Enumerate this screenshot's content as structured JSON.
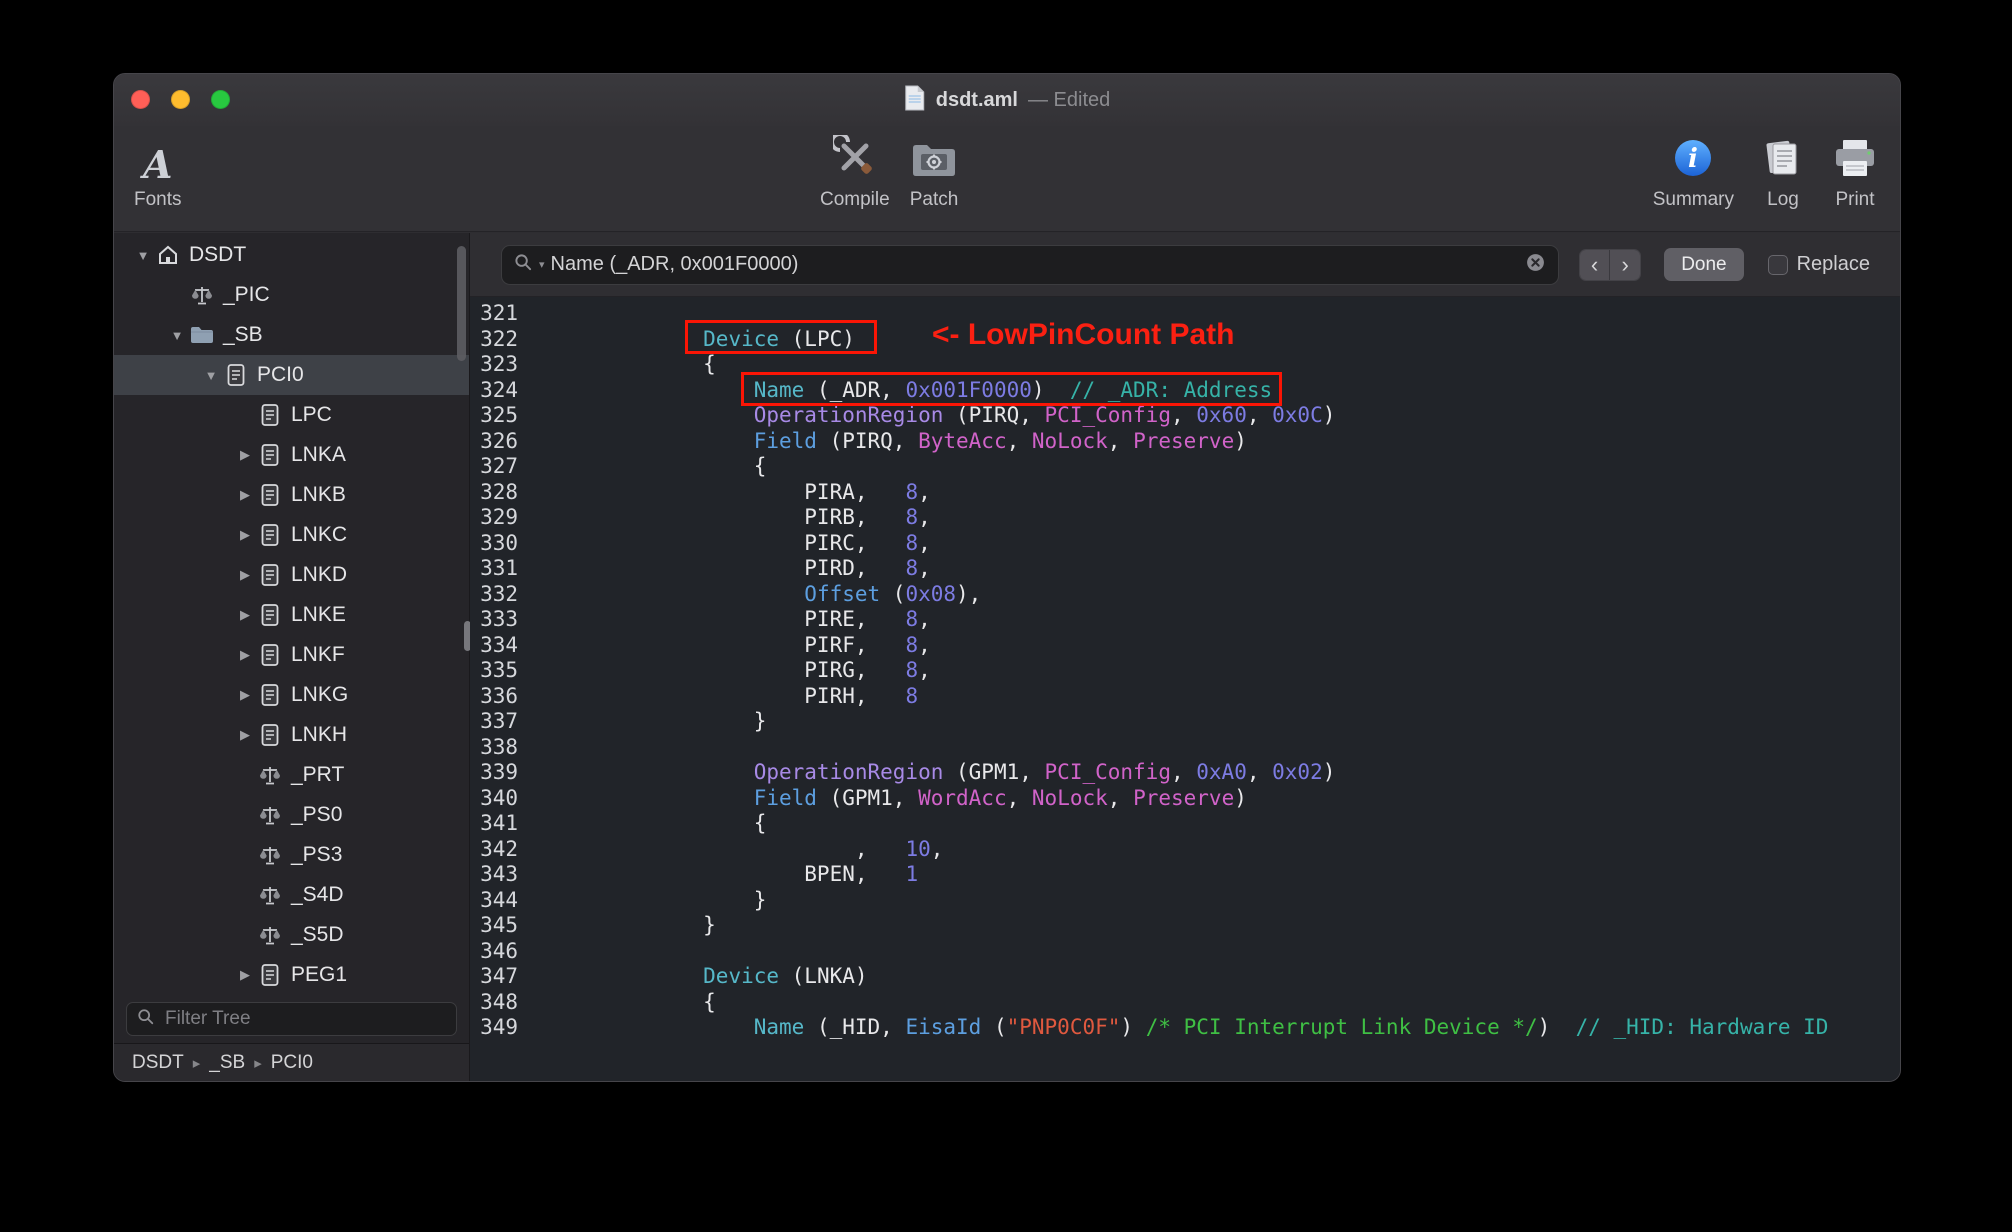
{
  "colors": {
    "annotation_red": "#fb1505",
    "keyword_teal": "#56b8c9",
    "keyword_purple": "#a88ae6",
    "keyword_blue": "#5d9fe0",
    "keyword_pink": "#d163c9",
    "number_purple": "#7d7ce3",
    "comment_teal": "#36b3a8",
    "comment_green": "#3fbf44",
    "string_red": "#e0593f",
    "info_blue": "#2f7cf6",
    "traffic_red": "#ff5f57",
    "traffic_yellow": "#febc2e",
    "traffic_green": "#28c840"
  },
  "window": {
    "title": "dsdt.aml",
    "edited_suffix": "— Edited",
    "toolbar": {
      "fonts": "Fonts",
      "compile": "Compile",
      "patch": "Patch",
      "summary": "Summary",
      "log": "Log",
      "print": "Print"
    }
  },
  "icons": {
    "triangle_open": "▼",
    "triangle_closed": "▶",
    "breadcrumb_separator": "▸",
    "prev": "‹",
    "next": "›",
    "fonts_glyph": "A",
    "search_caret": "▾"
  },
  "sidebar": {
    "filter_placeholder": "Filter Tree",
    "breadcrumb": [
      "DSDT",
      "_SB",
      "PCI0"
    ],
    "tree": [
      {
        "label": "DSDT",
        "icon": "home",
        "disclosure": "open",
        "level": 0,
        "selected": false
      },
      {
        "label": "_PIC",
        "icon": "method",
        "disclosure": "none",
        "level": 1,
        "selected": false
      },
      {
        "label": "_SB",
        "icon": "folder",
        "disclosure": "open",
        "level": 1,
        "selected": false
      },
      {
        "label": "PCI0",
        "icon": "device",
        "disclosure": "open",
        "level": 2,
        "selected": true
      },
      {
        "label": "LPC",
        "icon": "device",
        "disclosure": "none",
        "level": 3,
        "selected": false
      },
      {
        "label": "LNKA",
        "icon": "device",
        "disclosure": "closed",
        "level": 3,
        "selected": false
      },
      {
        "label": "LNKB",
        "icon": "device",
        "disclosure": "closed",
        "level": 3,
        "selected": false
      },
      {
        "label": "LNKC",
        "icon": "device",
        "disclosure": "closed",
        "level": 3,
        "selected": false
      },
      {
        "label": "LNKD",
        "icon": "device",
        "disclosure": "closed",
        "level": 3,
        "selected": false
      },
      {
        "label": "LNKE",
        "icon": "device",
        "disclosure": "closed",
        "level": 3,
        "selected": false
      },
      {
        "label": "LNKF",
        "icon": "device",
        "disclosure": "closed",
        "level": 3,
        "selected": false
      },
      {
        "label": "LNKG",
        "icon": "device",
        "disclosure": "closed",
        "level": 3,
        "selected": false
      },
      {
        "label": "LNKH",
        "icon": "device",
        "disclosure": "closed",
        "level": 3,
        "selected": false
      },
      {
        "label": "_PRT",
        "icon": "method",
        "disclosure": "none",
        "level": 3,
        "selected": false
      },
      {
        "label": "_PS0",
        "icon": "method",
        "disclosure": "none",
        "level": 3,
        "selected": false
      },
      {
        "label": "_PS3",
        "icon": "method",
        "disclosure": "none",
        "level": 3,
        "selected": false
      },
      {
        "label": "_S4D",
        "icon": "method",
        "disclosure": "none",
        "level": 3,
        "selected": false
      },
      {
        "label": "_S5D",
        "icon": "method",
        "disclosure": "none",
        "level": 3,
        "selected": false
      },
      {
        "label": "PEG1",
        "icon": "device",
        "disclosure": "closed",
        "level": 3,
        "selected": false
      }
    ]
  },
  "findbar": {
    "query": "Name (_ADR, 0x001F0000)",
    "done": "Done",
    "replace_label": "Replace"
  },
  "editor": {
    "annotation": "<- LowPinCount Path",
    "lines": [
      {
        "n": 321,
        "s": []
      },
      {
        "n": 322,
        "s": [
          {
            "c": "p",
            "t": "        "
          },
          {
            "c": "k1",
            "t": "Device"
          },
          {
            "c": "p",
            "t": " (LPC)"
          }
        ]
      },
      {
        "n": 323,
        "s": [
          {
            "c": "p",
            "t": "        {"
          }
        ]
      },
      {
        "n": 324,
        "s": [
          {
            "c": "p",
            "t": "            "
          },
          {
            "c": "k1",
            "t": "Name"
          },
          {
            "c": "p",
            "t": " (_ADR, "
          },
          {
            "c": "n",
            "t": "0x001F0000"
          },
          {
            "c": "p",
            "t": ")  "
          },
          {
            "c": "cm",
            "t": "// _ADR: Address"
          }
        ]
      },
      {
        "n": 325,
        "s": [
          {
            "c": "p",
            "t": "            "
          },
          {
            "c": "k2",
            "t": "OperationRegion"
          },
          {
            "c": "p",
            "t": " (PIRQ, "
          },
          {
            "c": "pk",
            "t": "PCI_Config"
          },
          {
            "c": "p",
            "t": ", "
          },
          {
            "c": "n",
            "t": "0x60"
          },
          {
            "c": "p",
            "t": ", "
          },
          {
            "c": "n",
            "t": "0x0C"
          },
          {
            "c": "p",
            "t": ")"
          }
        ]
      },
      {
        "n": 326,
        "s": [
          {
            "c": "p",
            "t": "            "
          },
          {
            "c": "k3",
            "t": "Field"
          },
          {
            "c": "p",
            "t": " (PIRQ, "
          },
          {
            "c": "pk",
            "t": "ByteAcc"
          },
          {
            "c": "p",
            "t": ", "
          },
          {
            "c": "pk",
            "t": "NoLock"
          },
          {
            "c": "p",
            "t": ", "
          },
          {
            "c": "pk",
            "t": "Preserve"
          },
          {
            "c": "p",
            "t": ")"
          }
        ]
      },
      {
        "n": 327,
        "s": [
          {
            "c": "p",
            "t": "            {"
          }
        ]
      },
      {
        "n": 328,
        "s": [
          {
            "c": "p",
            "t": "                PIRA,   "
          },
          {
            "c": "n",
            "t": "8"
          },
          {
            "c": "p",
            "t": ","
          }
        ]
      },
      {
        "n": 329,
        "s": [
          {
            "c": "p",
            "t": "                PIRB,   "
          },
          {
            "c": "n",
            "t": "8"
          },
          {
            "c": "p",
            "t": ","
          }
        ]
      },
      {
        "n": 330,
        "s": [
          {
            "c": "p",
            "t": "                PIRC,   "
          },
          {
            "c": "n",
            "t": "8"
          },
          {
            "c": "p",
            "t": ","
          }
        ]
      },
      {
        "n": 331,
        "s": [
          {
            "c": "p",
            "t": "                PIRD,   "
          },
          {
            "c": "n",
            "t": "8"
          },
          {
            "c": "p",
            "t": ","
          }
        ]
      },
      {
        "n": 332,
        "s": [
          {
            "c": "p",
            "t": "                "
          },
          {
            "c": "k3",
            "t": "Offset"
          },
          {
            "c": "p",
            "t": " ("
          },
          {
            "c": "n",
            "t": "0x08"
          },
          {
            "c": "p",
            "t": "),"
          }
        ]
      },
      {
        "n": 333,
        "s": [
          {
            "c": "p",
            "t": "                PIRE,   "
          },
          {
            "c": "n",
            "t": "8"
          },
          {
            "c": "p",
            "t": ","
          }
        ]
      },
      {
        "n": 334,
        "s": [
          {
            "c": "p",
            "t": "                PIRF,   "
          },
          {
            "c": "n",
            "t": "8"
          },
          {
            "c": "p",
            "t": ","
          }
        ]
      },
      {
        "n": 335,
        "s": [
          {
            "c": "p",
            "t": "                PIRG,   "
          },
          {
            "c": "n",
            "t": "8"
          },
          {
            "c": "p",
            "t": ","
          }
        ]
      },
      {
        "n": 336,
        "s": [
          {
            "c": "p",
            "t": "                PIRH,   "
          },
          {
            "c": "n",
            "t": "8"
          }
        ]
      },
      {
        "n": 337,
        "s": [
          {
            "c": "p",
            "t": "            }"
          }
        ]
      },
      {
        "n": 338,
        "s": []
      },
      {
        "n": 339,
        "s": [
          {
            "c": "p",
            "t": "            "
          },
          {
            "c": "k2",
            "t": "OperationRegion"
          },
          {
            "c": "p",
            "t": " (GPM1, "
          },
          {
            "c": "pk",
            "t": "PCI_Config"
          },
          {
            "c": "p",
            "t": ", "
          },
          {
            "c": "n",
            "t": "0xA0"
          },
          {
            "c": "p",
            "t": ", "
          },
          {
            "c": "n",
            "t": "0x02"
          },
          {
            "c": "p",
            "t": ")"
          }
        ]
      },
      {
        "n": 340,
        "s": [
          {
            "c": "p",
            "t": "            "
          },
          {
            "c": "k3",
            "t": "Field"
          },
          {
            "c": "p",
            "t": " (GPM1, "
          },
          {
            "c": "pk",
            "t": "WordAcc"
          },
          {
            "c": "p",
            "t": ", "
          },
          {
            "c": "pk",
            "t": "NoLock"
          },
          {
            "c": "p",
            "t": ", "
          },
          {
            "c": "pk",
            "t": "Preserve"
          },
          {
            "c": "p",
            "t": ")"
          }
        ]
      },
      {
        "n": 341,
        "s": [
          {
            "c": "p",
            "t": "            {"
          }
        ]
      },
      {
        "n": 342,
        "s": [
          {
            "c": "p",
            "t": "                    ,   "
          },
          {
            "c": "n",
            "t": "10"
          },
          {
            "c": "p",
            "t": ","
          }
        ]
      },
      {
        "n": 343,
        "s": [
          {
            "c": "p",
            "t": "                BPEN,   "
          },
          {
            "c": "n",
            "t": "1"
          }
        ]
      },
      {
        "n": 344,
        "s": [
          {
            "c": "p",
            "t": "            }"
          }
        ]
      },
      {
        "n": 345,
        "s": [
          {
            "c": "p",
            "t": "        }"
          }
        ]
      },
      {
        "n": 346,
        "s": []
      },
      {
        "n": 347,
        "s": [
          {
            "c": "p",
            "t": "        "
          },
          {
            "c": "k1",
            "t": "Device"
          },
          {
            "c": "p",
            "t": " (LNKA)"
          }
        ]
      },
      {
        "n": 348,
        "s": [
          {
            "c": "p",
            "t": "        {"
          }
        ]
      },
      {
        "n": 349,
        "s": [
          {
            "c": "p",
            "t": "            "
          },
          {
            "c": "k1",
            "t": "Name"
          },
          {
            "c": "p",
            "t": " (_HID, "
          },
          {
            "c": "k3",
            "t": "EisaId"
          },
          {
            "c": "p",
            "t": " ("
          },
          {
            "c": "st",
            "t": "\"PNP0C0F\""
          },
          {
            "c": "p",
            "t": ") "
          },
          {
            "c": "gn",
            "t": "/* PCI Interrupt Link Device */"
          },
          {
            "c": "p",
            "t": ")  "
          },
          {
            "c": "cm",
            "t": "// _HID: Hardware ID"
          }
        ]
      }
    ]
  }
}
